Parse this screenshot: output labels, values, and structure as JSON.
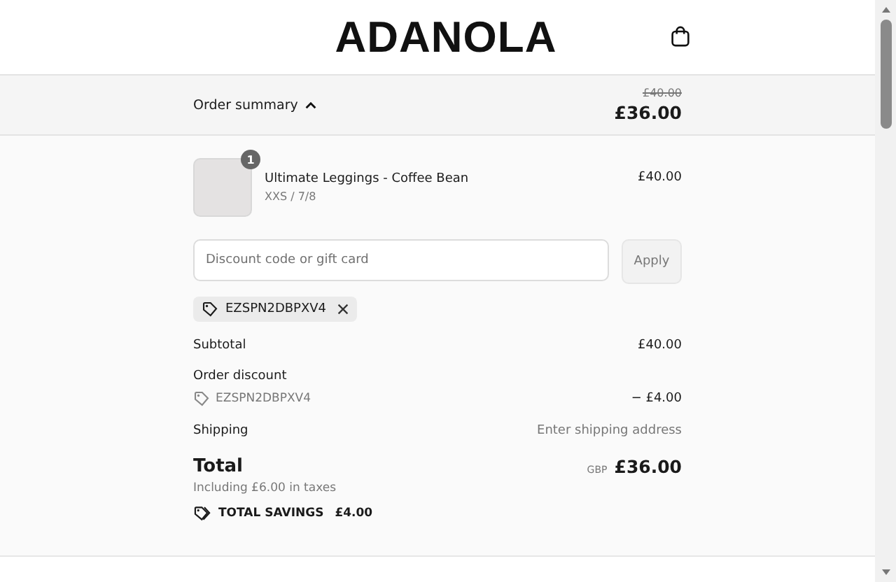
{
  "header": {
    "logo": "ADANOLA"
  },
  "summary_bar": {
    "label": "Order summary",
    "expanded": true,
    "original_price": "£40.00",
    "price": "£36.00"
  },
  "line_items": [
    {
      "quantity": "1",
      "name": "Ultimate Leggings - Coffee Bean",
      "variant": "XXS / 7/8",
      "price": "£40.00"
    }
  ],
  "discount": {
    "placeholder": "Discount code or gift card",
    "button": "Apply",
    "applied_codes": [
      "EZSPN2DBPXV4"
    ]
  },
  "totals": {
    "subtotal": {
      "label": "Subtotal",
      "value": "£40.00"
    },
    "order_discount": {
      "label": "Order discount",
      "code": "EZSPN2DBPXV4",
      "value": "− £4.00"
    },
    "shipping": {
      "label": "Shipping",
      "value": "Enter shipping address"
    },
    "total": {
      "label": "Total",
      "currency": "GBP",
      "value": "£36.00"
    },
    "taxes": "Including £6.00 in taxes",
    "savings": {
      "label": "TOTAL SAVINGS",
      "value": "£4.00"
    }
  }
}
